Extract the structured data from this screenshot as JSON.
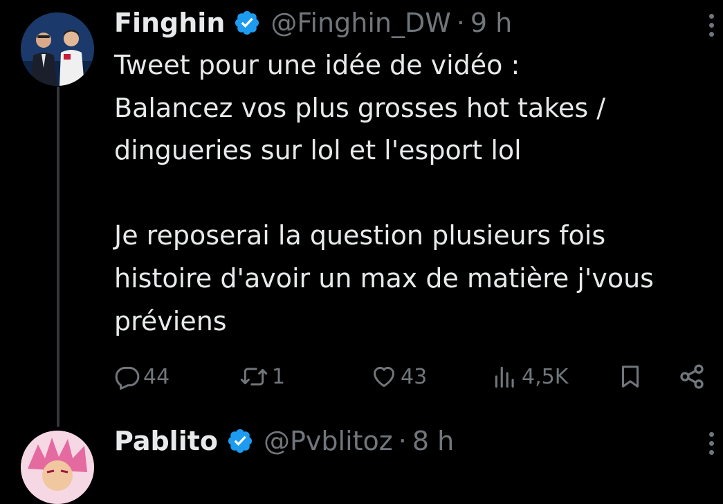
{
  "colors": {
    "background": "#000000",
    "text": "#e7e9ea",
    "muted": "#71767b",
    "verified": "#1d9bf0",
    "thread_line": "#333639"
  },
  "tweets": [
    {
      "name": "Finghin",
      "handle": "@Finghin_DW",
      "separator": "·",
      "time": "9 h",
      "verified_icon": "verified-badge-icon",
      "text": [
        "Tweet pour une idée de vidéo :",
        "Balancez vos plus grosses hot takes /",
        "dingueries sur lol et l'esport lol",
        "",
        "Je reposerai la question plusieurs fois",
        "histoire d'avoir un max de matière j'vous",
        "préviens"
      ],
      "actions": {
        "replies": "44",
        "retweets": "1",
        "likes": "43",
        "views": "4,5K"
      }
    },
    {
      "name": "Pablito",
      "handle": "@Pvblitoz",
      "separator": "·",
      "time": "8 h",
      "verified_icon": "verified-badge-icon"
    }
  ],
  "icons": {
    "reply": "reply-icon",
    "retweet": "retweet-icon",
    "like": "heart-icon",
    "views": "views-icon",
    "bookmark": "bookmark-icon",
    "share": "share-icon",
    "more": "more-vertical-icon"
  }
}
